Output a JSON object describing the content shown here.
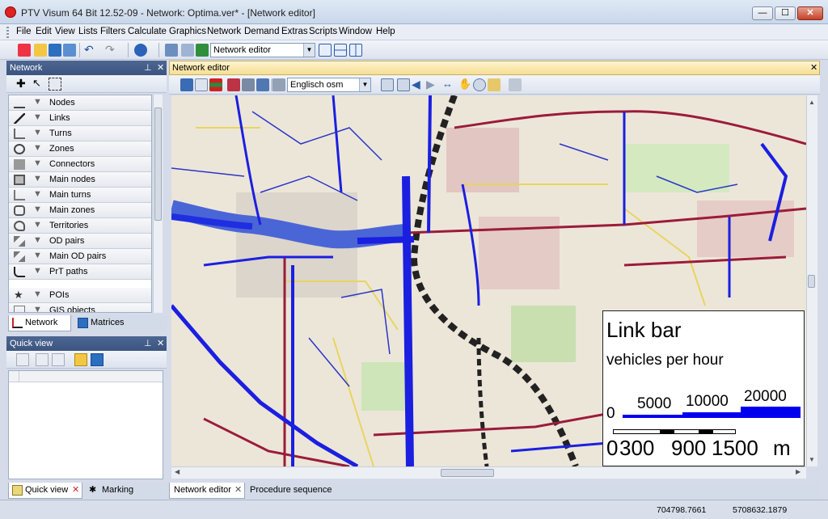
{
  "window": {
    "title": "PTV Visum 64 Bit 12.52-09 - Network: Optima.ver* - [Network editor]",
    "min_label": "—",
    "max_label": "☐",
    "close_label": "✕"
  },
  "menu": [
    "File",
    "Edit",
    "View",
    "Lists",
    "Filters",
    "Calculate",
    "Graphics",
    "Network",
    "Demand",
    "Extras",
    "Scripts",
    "Window",
    "Help"
  ],
  "toolbar": {
    "view_combo": "Network editor"
  },
  "network_pane": {
    "title": "Network",
    "items": [
      "Nodes",
      "Links",
      "Turns",
      "Zones",
      "Connectors",
      "Main nodes",
      "Main turns",
      "Main zones",
      "Territories",
      "OD pairs",
      "Main OD pairs",
      "PrT paths",
      "POIs",
      "GIS objects"
    ],
    "tabs": [
      "Network",
      "Matrices"
    ]
  },
  "quickview_pane": {
    "title": "Quick view",
    "tabs": [
      "Quick view",
      "Marking"
    ]
  },
  "editor": {
    "title": "Network editor",
    "background_map": "Englisch osm",
    "tabs": [
      "Network editor",
      "Procedure sequence"
    ]
  },
  "legend": {
    "title": "Link bar",
    "subtitle": "vehicles per hour",
    "bar_values": [
      "0",
      "5000",
      "10000",
      "20000"
    ],
    "scale_values": [
      "0",
      "300",
      "900",
      "1500",
      "m"
    ]
  },
  "status": {
    "x": "704798.7661",
    "y": "5708632.1879"
  },
  "colors": {
    "link_bar": "#0000ee",
    "major_road": "#9b1b3a",
    "secondary_road": "#e9d96a",
    "pane_header": "#3c5580",
    "editor_header": "#f6df93"
  }
}
